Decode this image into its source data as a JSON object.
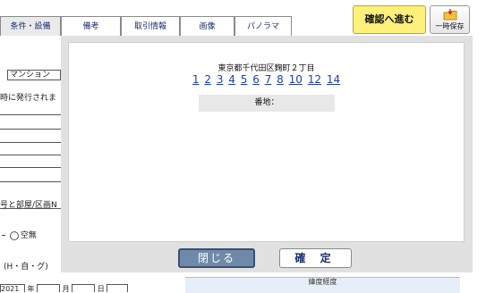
{
  "tabs": [
    {
      "label": "条件・設備"
    },
    {
      "label": "備考"
    },
    {
      "label": "取引情報"
    },
    {
      "label": "画像"
    },
    {
      "label": "パノラマ"
    }
  ],
  "toolbar": {
    "confirm_label": "確認へ進む",
    "save_label": "一時保存",
    "confirm_color": "#fdf07b"
  },
  "background_form": {
    "mansion_value": "マンション",
    "issue_text": "時に発行されま",
    "room_text": "号と部屋/区画N",
    "vacant_label": "空無",
    "structure_text": "(H・自・グ)",
    "bottom_prefix": "2021",
    "bottom_sep1": "年",
    "bottom_sep2": "月",
    "bottom_sep3": "日",
    "lat_label": "緯度経度"
  },
  "dialog": {
    "address": "東京都千代田区麹町２丁目",
    "block_numbers": [
      "1",
      "2",
      "3",
      "4",
      "5",
      "6",
      "7",
      "8",
      "10",
      "12",
      "14"
    ],
    "banchi_label": "番地：",
    "close_label": "閉じる",
    "ok_label": "確 定",
    "close_color": "#6f8aa8"
  }
}
